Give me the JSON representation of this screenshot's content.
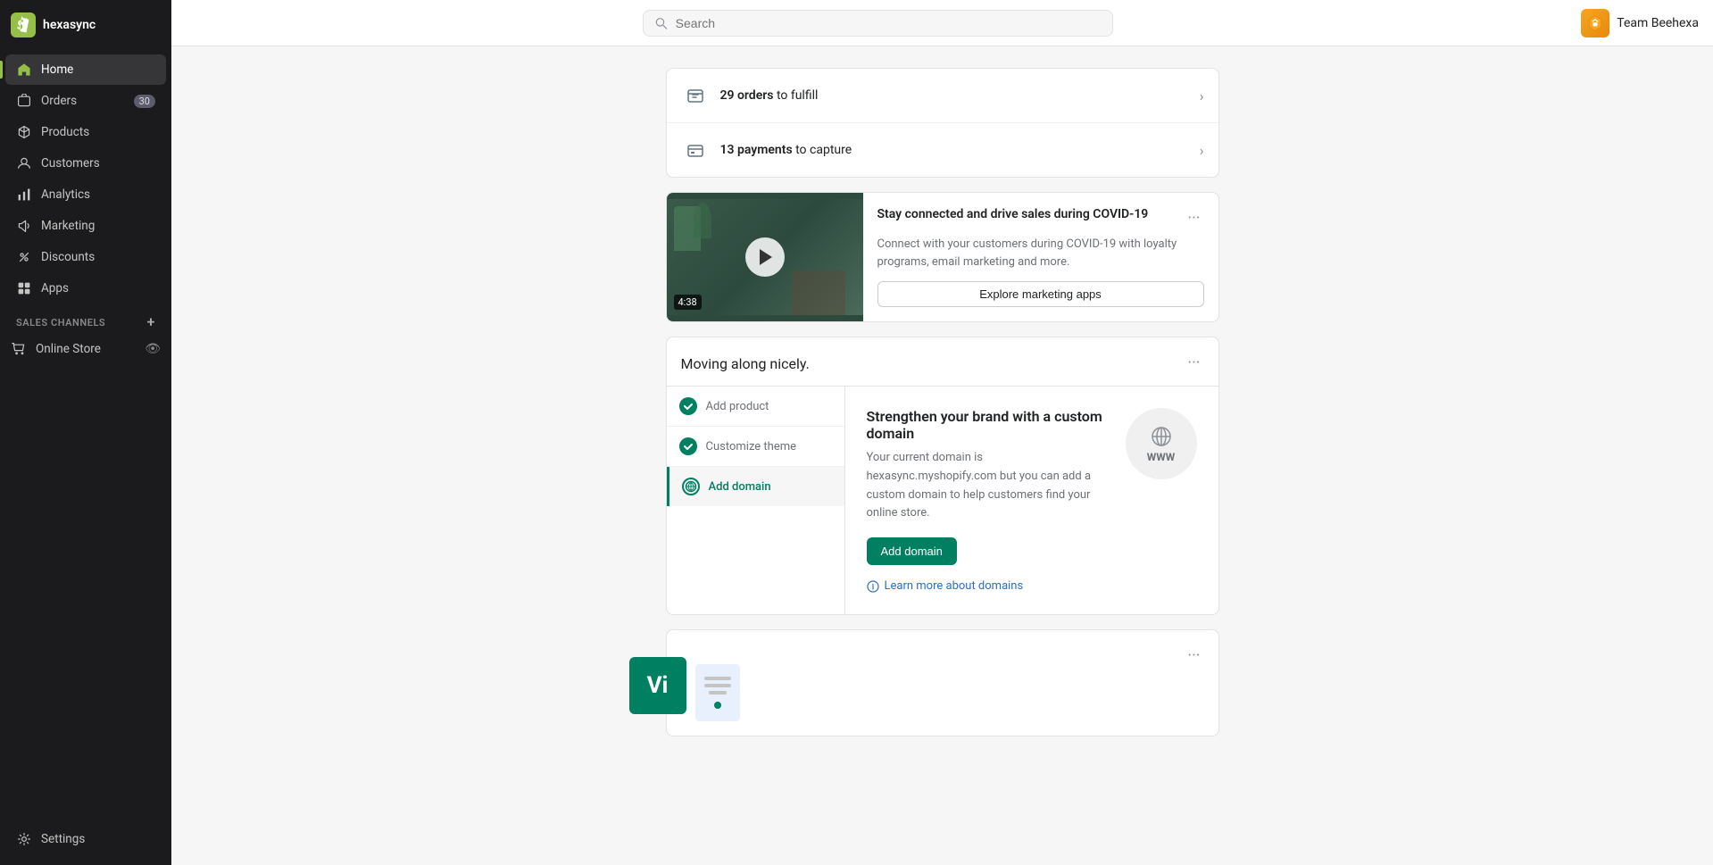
{
  "sidebar": {
    "store_name": "hexasync",
    "nav_items": [
      {
        "id": "home",
        "label": "Home",
        "icon": "home-icon",
        "active": true
      },
      {
        "id": "orders",
        "label": "Orders",
        "icon": "orders-icon",
        "badge": "30"
      },
      {
        "id": "products",
        "label": "Products",
        "icon": "products-icon"
      },
      {
        "id": "customers",
        "label": "Customers",
        "icon": "customers-icon"
      },
      {
        "id": "analytics",
        "label": "Analytics",
        "icon": "analytics-icon"
      },
      {
        "id": "marketing",
        "label": "Marketing",
        "icon": "marketing-icon"
      },
      {
        "id": "discounts",
        "label": "Discounts",
        "icon": "discounts-icon"
      },
      {
        "id": "apps",
        "label": "Apps",
        "icon": "apps-icon"
      }
    ],
    "sales_channels_label": "SALES CHANNELS",
    "online_store_label": "Online Store",
    "settings_label": "Settings"
  },
  "topbar": {
    "search_placeholder": "Search",
    "team_label": "Team Beehexa"
  },
  "action_cards": {
    "orders_text": "29 orders",
    "orders_suffix": " to fulfill",
    "payments_text": "13 payments",
    "payments_suffix": " to capture"
  },
  "video_card": {
    "title": "Stay connected and drive sales during COVID-19",
    "description": "Connect with your customers during COVID-19 with loyalty programs, email marketing and more.",
    "explore_btn": "Explore marketing apps",
    "duration": "4:38",
    "more_icon": "more-icon"
  },
  "progress_card": {
    "title": "Moving along nicely.",
    "more_icon": "more-icon",
    "steps": [
      {
        "id": "add-product",
        "label": "Add product",
        "completed": true
      },
      {
        "id": "customize-theme",
        "label": "Customize theme",
        "completed": true
      },
      {
        "id": "add-domain",
        "label": "Add domain",
        "completed": false,
        "active": true
      }
    ],
    "detail": {
      "title": "Strengthen your brand with a custom domain",
      "description": "Your current domain is hexasync.myshopify.com but you can add a custom domain to help customers find your online store.",
      "add_btn": "Add domain",
      "learn_link": "Learn more about domains",
      "www_text": "WWW"
    }
  },
  "bottom_card": {
    "more_icon": "more-icon"
  }
}
